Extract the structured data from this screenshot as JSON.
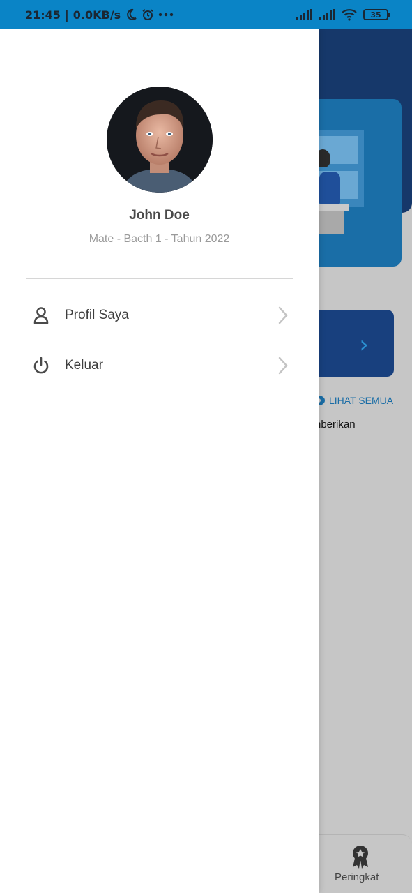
{
  "status_bar": {
    "time": "21:45",
    "speed": "0.0KB/s",
    "icons": [
      "moon-icon",
      "alarm-icon",
      "more-icon",
      "signal-icon",
      "signal-icon",
      "wifi-icon"
    ],
    "battery": "35"
  },
  "drawer": {
    "user": {
      "name": "John Doe",
      "subtitle": "Mate - Bacth 1 - Tahun 2022",
      "avatar": "profile-photo"
    },
    "menu": [
      {
        "label": "Profil Saya",
        "icon": "user-icon"
      },
      {
        "label": "Keluar",
        "icon": "power-icon"
      }
    ]
  },
  "background": {
    "see_all": "LIHAT SEMUA",
    "partial_text": "nberikan",
    "bottom_nav_label": "Peringkat"
  },
  "colors": {
    "status_bar": "#0a84c6",
    "header": "#16386a",
    "accent": "#1a6da6"
  }
}
